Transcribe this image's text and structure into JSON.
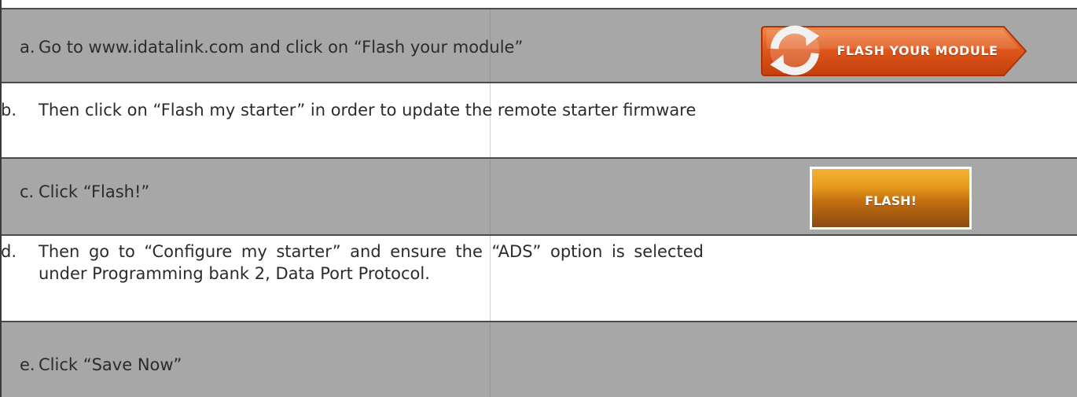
{
  "steps": [
    {
      "letter": "a.",
      "text": "Go to www.idatalink.com and click on “Flash your module”"
    },
    {
      "letter": "b.",
      "text": "Then click on “Flash my starter” in order to update the remote starter firmware"
    },
    {
      "letter": "c.",
      "text": "Click “Flash!”"
    },
    {
      "letter": "d.",
      "text": "Then go to “Configure my starter” and ensure the “ADS” option is selected under Programming bank 2, Data Port Protocol."
    },
    {
      "letter": "e.",
      "text": "Click “Save Now”"
    }
  ],
  "buttons": {
    "flash_module_label": "FLASH YOUR MODULE",
    "flash_label": "FLASH!"
  },
  "colors": {
    "row_gray": "#a7a7a7",
    "row_white": "#ffffff",
    "module_button_orange": "#e0581c",
    "flash_button_orange": "#e69b1c"
  },
  "icons": {
    "module_button_icon": "refresh-arrows-icon"
  }
}
